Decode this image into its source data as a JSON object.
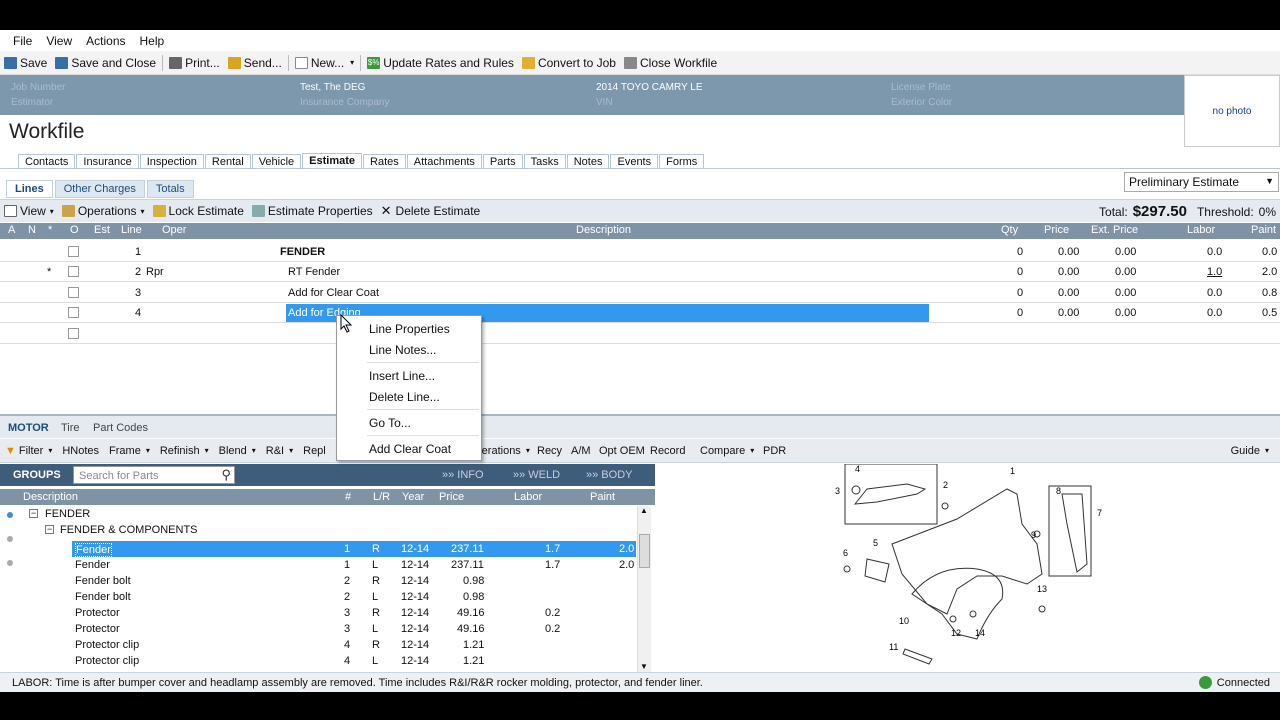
{
  "menu": [
    "File",
    "View",
    "Actions",
    "Help"
  ],
  "toolbar": {
    "save": "Save",
    "save_close": "Save and Close",
    "print": "Print...",
    "send": "Send...",
    "new": "New...",
    "update_rates": "Update Rates and Rules",
    "convert": "Convert to Job",
    "close_workfile": "Close Workfile"
  },
  "header": {
    "customer": "Test, The DEG",
    "vehicle": "2014 TOYO CAMRY LE",
    "job_number_label": "Job Number",
    "estimator_label": "Estimator",
    "insurance_label": "Insurance Company",
    "vin_label": "VIN",
    "license_label": "License Plate",
    "exterior_label": "Exterior Color",
    "photo_text": "no photo"
  },
  "page_title": "Workfile",
  "tabs": [
    "Contacts",
    "Insurance",
    "Inspection",
    "Rental",
    "Vehicle",
    "Estimate",
    "Rates",
    "Attachments",
    "Parts",
    "Tasks",
    "Notes",
    "Events",
    "Forms"
  ],
  "active_tab": "Estimate",
  "subtabs": [
    "Lines",
    "Other Charges",
    "Totals"
  ],
  "estimate_select": "Preliminary Estimate",
  "est_toolbar": {
    "view": "View",
    "operations": "Operations",
    "lock": "Lock Estimate",
    "properties": "Estimate Properties",
    "delete": "Delete Estimate",
    "total_label": "Total:",
    "total_value": "$297.50",
    "threshold_label": "Threshold:",
    "threshold_value": "0%"
  },
  "grid_headers": {
    "a": "A",
    "n": "N",
    "star": "*",
    "o": "O",
    "est": "Est",
    "line": "Line",
    "oper": "Oper",
    "description": "Description",
    "qty": "Qty",
    "price": "Price",
    "ext_price": "Ext. Price",
    "labor": "Labor",
    "paint": "Paint"
  },
  "lines": [
    {
      "star": "",
      "line": "1",
      "oper": "",
      "description": "FENDER",
      "qty": "0",
      "price": "0.00",
      "ext": "0.00",
      "labor": "0.0",
      "paint": "0.0"
    },
    {
      "star": "*",
      "line": "2",
      "oper": "Rpr",
      "description": "RT Fender",
      "qty": "0",
      "price": "0.00",
      "ext": "0.00",
      "labor": "1.0",
      "paint": "2.0"
    },
    {
      "star": "",
      "line": "3",
      "oper": "",
      "description": "Add for Clear Coat",
      "qty": "0",
      "price": "0.00",
      "ext": "0.00",
      "labor": "0.0",
      "paint": "0.8"
    },
    {
      "star": "",
      "line": "4",
      "oper": "",
      "description": "Add for Edging",
      "qty": "0",
      "price": "0.00",
      "ext": "0.00",
      "labor": "0.0",
      "paint": "0.5"
    }
  ],
  "context_menu": [
    "Line Properties",
    "Line Notes...",
    "Insert Line...",
    "Delete Line...",
    "Go To...",
    "Add Clear Coat"
  ],
  "motor_tabs": [
    "MOTOR",
    "Tire",
    "Part Codes"
  ],
  "filter_bar": [
    "Filter",
    "HNotes",
    "Frame",
    "Refinish",
    "Blend",
    "R&I",
    "Repl",
    "Operations",
    "Recy",
    "A/M",
    "Opt OEM",
    "Record",
    "Compare",
    "PDR",
    "Guide"
  ],
  "groups": {
    "label": "GROUPS",
    "search_placeholder": "Search for Parts",
    "info": "INFO",
    "weld": "WELD",
    "body": "BODY"
  },
  "parts_headers": {
    "description": "Description",
    "num": "#",
    "lr": "L/R",
    "year": "Year",
    "price": "Price",
    "labor": "Labor",
    "paint": "Paint"
  },
  "tree": {
    "group": "FENDER",
    "subgroup": "FENDER & COMPONENTS"
  },
  "parts": [
    {
      "desc": "Fender",
      "num": "1",
      "lr": "R",
      "year": "12-14",
      "price": "237.11",
      "labor": "1.7",
      "paint": "2.0"
    },
    {
      "desc": "Fender",
      "num": "1",
      "lr": "L",
      "year": "12-14",
      "price": "237.11",
      "labor": "1.7",
      "paint": "2.0"
    },
    {
      "desc": "Fender bolt",
      "num": "2",
      "lr": "R",
      "year": "12-14",
      "price": "0.98",
      "labor": "",
      "paint": ""
    },
    {
      "desc": "Fender bolt",
      "num": "2",
      "lr": "L",
      "year": "12-14",
      "price": "0.98",
      "labor": "",
      "paint": ""
    },
    {
      "desc": "Protector",
      "num": "3",
      "lr": "R",
      "year": "12-14",
      "price": "49.16",
      "labor": "0.2",
      "paint": ""
    },
    {
      "desc": "Protector",
      "num": "3",
      "lr": "L",
      "year": "12-14",
      "price": "49.16",
      "labor": "0.2",
      "paint": ""
    },
    {
      "desc": "Protector clip",
      "num": "4",
      "lr": "R",
      "year": "12-14",
      "price": "1.21",
      "labor": "",
      "paint": ""
    },
    {
      "desc": "Protector clip",
      "num": "4",
      "lr": "L",
      "year": "12-14",
      "price": "1.21",
      "labor": "",
      "paint": ""
    }
  ],
  "diagram_labels": [
    "1",
    "2",
    "3",
    "4",
    "5",
    "6",
    "7",
    "8",
    "9",
    "10",
    "11",
    "12",
    "13",
    "14"
  ],
  "status": {
    "message": "LABOR: Time is after bumper cover and headlamp assembly are removed. Time includes R&I/R&R rocker molding, protector, and fender liner.",
    "connection": "Connected"
  }
}
